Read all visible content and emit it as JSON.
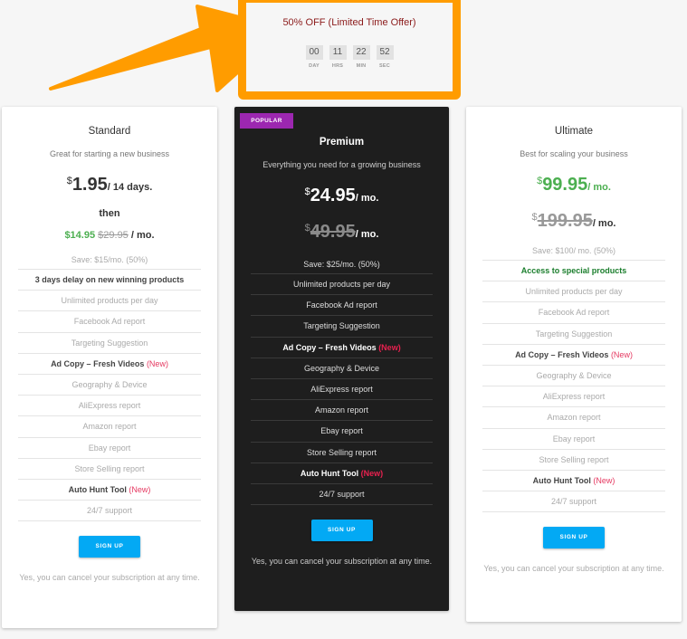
{
  "offer": {
    "title": "50% OFF (Limited Time Offer)",
    "timer": [
      {
        "value": "00",
        "label": "DAY"
      },
      {
        "value": "11",
        "label": "HRS"
      },
      {
        "value": "22",
        "label": "MIN"
      },
      {
        "value": "52",
        "label": "SEC"
      }
    ],
    "highlight_color": "#ff9c00"
  },
  "plans": {
    "standard": {
      "name": "Standard",
      "description": "Great for starting a new business",
      "currency": "$",
      "price": "1.95",
      "period": "/ 14 days.",
      "then_label": "then",
      "then_price": "$14.95",
      "then_old_price": "$29.95",
      "then_period": "/ mo.",
      "save": "Save: $15/mo. (50%)",
      "features": [
        {
          "text": "3 days delay on new winning products",
          "style": "bold"
        },
        {
          "text": "Unlimited products per day",
          "style": ""
        },
        {
          "text": "Facebook Ad report",
          "style": ""
        },
        {
          "text": "Targeting Suggestion",
          "style": ""
        },
        {
          "text": "Ad Copy – Fresh Videos",
          "style": "bold",
          "tag": "(New)"
        },
        {
          "text": "Geography & Device",
          "style": ""
        },
        {
          "text": "AliExpress report",
          "style": ""
        },
        {
          "text": "Amazon report",
          "style": ""
        },
        {
          "text": "Ebay report",
          "style": ""
        },
        {
          "text": "Store Selling report",
          "style": ""
        },
        {
          "text": "Auto Hunt Tool",
          "style": "bold",
          "tag": "(New)"
        },
        {
          "text": "24/7 support",
          "style": ""
        }
      ],
      "signup_label": "SIGN UP",
      "cancel_note": "Yes, you can cancel your subscription at any time."
    },
    "premium": {
      "badge": "POPULAR",
      "name": "Premium",
      "description": "Everything you need for a growing business",
      "currency": "$",
      "price": "24.95",
      "period": "/ mo.",
      "old_currency": "$",
      "old_price": "49.95",
      "old_period": "/ mo.",
      "save": "Save: $25/mo. (50%)",
      "features": [
        {
          "text": "Unlimited products per day",
          "style": ""
        },
        {
          "text": "Facebook Ad report",
          "style": ""
        },
        {
          "text": "Targeting Suggestion",
          "style": ""
        },
        {
          "text": "Ad Copy – Fresh Videos",
          "style": "bold",
          "tag": "(New)"
        },
        {
          "text": "Geography & Device",
          "style": ""
        },
        {
          "text": "AliExpress report",
          "style": ""
        },
        {
          "text": "Amazon report",
          "style": ""
        },
        {
          "text": "Ebay report",
          "style": ""
        },
        {
          "text": "Store Selling report",
          "style": ""
        },
        {
          "text": "Auto Hunt Tool",
          "style": "bold",
          "tag": "(New)"
        },
        {
          "text": "24/7 support",
          "style": ""
        }
      ],
      "signup_label": "SIGN UP",
      "cancel_note": "Yes, you can cancel your subscription at any time."
    },
    "ultimate": {
      "name": "Ultimate",
      "description": "Best for scaling your business",
      "currency": "$",
      "price": "99.95",
      "period": "/ mo.",
      "old_currency": "$",
      "old_price": "199.95",
      "old_period": "/ mo.",
      "save": "Save: $100/ mo. (50%)",
      "features": [
        {
          "text": "Access to special products",
          "style": "special"
        },
        {
          "text": "Unlimited products per day",
          "style": ""
        },
        {
          "text": "Facebook Ad report",
          "style": ""
        },
        {
          "text": "Targeting Suggestion",
          "style": ""
        },
        {
          "text": "Ad Copy – Fresh Videos",
          "style": "bold",
          "tag": "(New)"
        },
        {
          "text": "Geography & Device",
          "style": ""
        },
        {
          "text": "AliExpress report",
          "style": ""
        },
        {
          "text": "Amazon report",
          "style": ""
        },
        {
          "text": "Ebay report",
          "style": ""
        },
        {
          "text": "Store Selling report",
          "style": ""
        },
        {
          "text": "Auto Hunt Tool",
          "style": "bold",
          "tag": "(New)"
        },
        {
          "text": "24/7 support",
          "style": ""
        }
      ],
      "signup_label": "SIGN UP",
      "cancel_note": "Yes, you can cancel your subscription at any time."
    }
  },
  "colors": {
    "accent_button": "#03a9f4",
    "badge": "#9c27b0",
    "green_price": "#4caf50",
    "new_tag": "#e53961",
    "offer_text": "#8b1a1a"
  }
}
